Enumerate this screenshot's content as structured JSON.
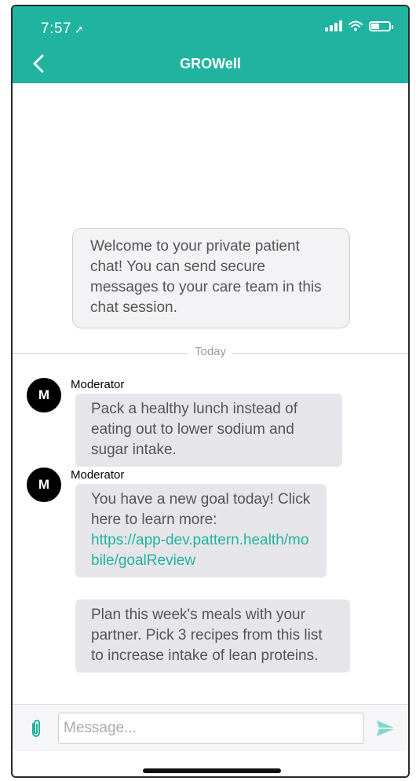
{
  "status_bar": {
    "time": "7:57",
    "location_glyph": "➚"
  },
  "header": {
    "title": "GROWell",
    "back_icon": "chevron-left-icon"
  },
  "welcome": {
    "text": "Welcome to your private patient chat!  You can send secure messages to your care team in this chat session."
  },
  "divider": {
    "label": "Today"
  },
  "messages": [
    {
      "avatar": "M",
      "sender": "Moderator",
      "text": "Pack a healthy lunch instead of eating out to lower sodium and sugar intake."
    },
    {
      "avatar": "M",
      "sender": "Moderator",
      "text": "You have a new goal today! Click here to learn more:",
      "link": "https://app-dev.pattern.health/mobile/goalReview"
    },
    {
      "text": "Plan this week's meals with your partner. Pick 3 recipes from this list to increase intake of lean proteins."
    }
  ],
  "composer": {
    "placeholder": "Message..."
  },
  "colors": {
    "accent": "#20b39f",
    "bubble": "#e6e6ea"
  }
}
